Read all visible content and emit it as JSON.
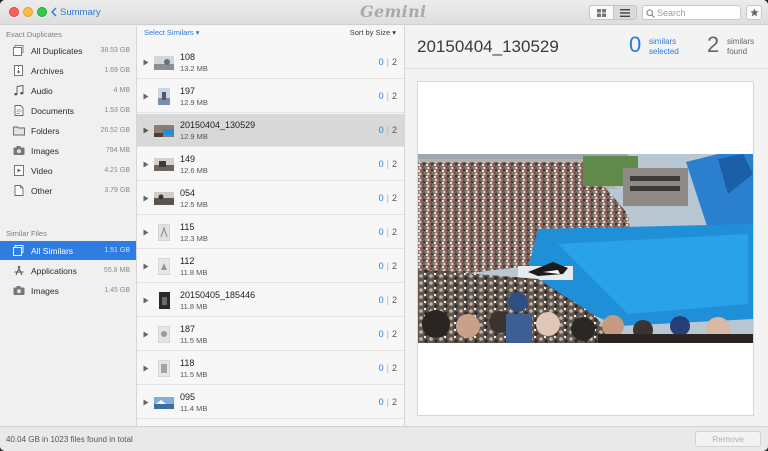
{
  "titlebar": {
    "back_label": "Summary",
    "app_name": "Gemini",
    "search_placeholder": "Search",
    "icons": [
      "grid-view-icon",
      "list-view-icon",
      "search-icon",
      "star-icon"
    ]
  },
  "sidebar": {
    "exact_header": "Exact Duplicates",
    "exact_items": [
      {
        "label": "All Duplicates",
        "size": "38.53 GB",
        "icon": "stack-icon"
      },
      {
        "label": "Archives",
        "size": "1.69 GB",
        "icon": "archive-icon"
      },
      {
        "label": "Audio",
        "size": "4 MB",
        "icon": "music-note-icon"
      },
      {
        "label": "Documents",
        "size": "1.53 GB",
        "icon": "document-icon"
      },
      {
        "label": "Folders",
        "size": "26.52 GB",
        "icon": "folder-icon"
      },
      {
        "label": "Images",
        "size": "794 MB",
        "icon": "camera-icon"
      },
      {
        "label": "Video",
        "size": "4.21 GB",
        "icon": "video-icon"
      },
      {
        "label": "Other",
        "size": "3.79 GB",
        "icon": "file-icon"
      }
    ],
    "similar_header": "Similar Files",
    "similar_items": [
      {
        "label": "All Similars",
        "size": "1.51 GB",
        "icon": "stack-icon",
        "selected": true
      },
      {
        "label": "Applications",
        "size": "55.8 MB",
        "icon": "app-store-icon"
      },
      {
        "label": "Images",
        "size": "1.45 GB",
        "icon": "camera-icon"
      }
    ]
  },
  "list": {
    "select_label": "Select Similars",
    "sort_label": "Sort by Size",
    "rows": [
      {
        "name": "108",
        "size": "13.2 MB",
        "selected": "0",
        "total": "2",
        "thumb": "landscape-photo"
      },
      {
        "name": "197",
        "size": "12.9 MB",
        "selected": "0",
        "total": "2",
        "thumb": "portrait-photo"
      },
      {
        "name": "20150404_130529",
        "size": "12.9 MB",
        "selected": "0",
        "total": "2",
        "thumb": "stadium-photo",
        "active": true
      },
      {
        "name": "149",
        "size": "12.6 MB",
        "selected": "0",
        "total": "2",
        "thumb": "landscape-photo"
      },
      {
        "name": "054",
        "size": "12.5 MB",
        "selected": "0",
        "total": "2",
        "thumb": "landscape-photo"
      },
      {
        "name": "115",
        "size": "12.3 MB",
        "selected": "0",
        "total": "2",
        "thumb": "portrait-photo"
      },
      {
        "name": "112",
        "size": "11.8 MB",
        "selected": "0",
        "total": "2",
        "thumb": "portrait-photo"
      },
      {
        "name": "20150405_185446",
        "size": "11.8 MB",
        "selected": "0",
        "total": "2",
        "thumb": "dark-portrait-photo"
      },
      {
        "name": "187",
        "size": "11.5 MB",
        "selected": "0",
        "total": "2",
        "thumb": "portrait-photo"
      },
      {
        "name": "118",
        "size": "11.5 MB",
        "selected": "0",
        "total": "2",
        "thumb": "portrait-photo"
      },
      {
        "name": "095",
        "size": "11.4 MB",
        "selected": "0",
        "total": "2",
        "thumb": "sky-photo"
      }
    ]
  },
  "detail": {
    "title": "20150404_130529",
    "selected_count": "0",
    "selected_line1": "similars",
    "selected_line2": "selected",
    "found_count": "2",
    "found_line1": "similars",
    "found_line2": "found"
  },
  "footer": {
    "totals": "40.04 GB in 1023 files found in total",
    "remove_label": "Remove"
  },
  "colors": {
    "accent": "#2f7de0",
    "link": "#2c7ad6",
    "pool": "#1f8fd8",
    "sidebar_bg": "#f0f0f0"
  }
}
